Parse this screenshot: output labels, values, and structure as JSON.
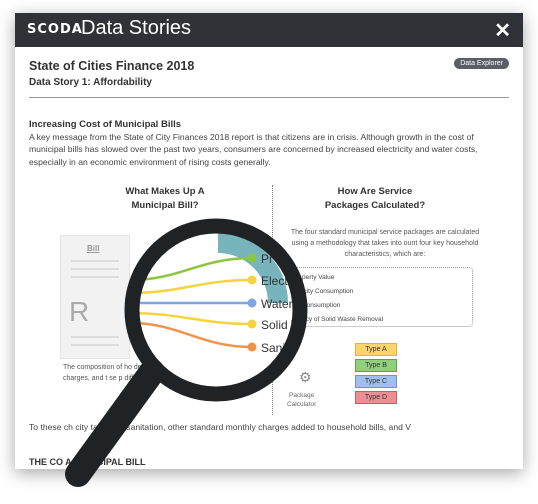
{
  "header": {
    "brand": "SCODA",
    "title": "Data Stories",
    "close_label": "✕"
  },
  "doc": {
    "title": "State of Cities Finance 2018",
    "subtitle": "Data Story 1: Affordability",
    "badge": "Data Explorer"
  },
  "section": {
    "heading": "Increasing Cost of Municipal Bills",
    "paragraph": "A key message from the State of City Finances 2018 report is that citizens are in crisis. Although growth in the cost of municipal bills has slowed over the past two years, consumers are concerned by increased electricity and water costs, especially in an economic environment of rising costs generally."
  },
  "left_column": {
    "heading_line1": "What Makes Up A",
    "heading_line2": "Municipal Bill?",
    "bill_label": "Bill",
    "bill_letter": "R",
    "magnified_items": [
      "Pr",
      "Electr",
      "Water C",
      "Solid W",
      "Sanitat"
    ],
    "caption": "The composition of ho depends on how city r charges, and t se p different s ed b"
  },
  "right_column": {
    "heading_line1": "How Are Service",
    "heading_line2": "Packages Calculated?",
    "intro": "The four standard municipal service packages are calculated using a methodology that takes into ount four key household characteristics, which are:",
    "characteristics": [
      "perty Value",
      "icity Consumption",
      "Consumption",
      "ncy of Solid Waste Removal"
    ],
    "package_label_1": "Package",
    "package_label_2": "Calculator",
    "types": [
      "Type A",
      "Type B",
      "Type C",
      "Type D"
    ]
  },
  "bottom": {
    "paragraph": "To these ch city tariffs for sanitation, other standard monthly charges added to household bills, and V",
    "heading": "THE CO A MUNICIPAL BILL"
  },
  "colors": {
    "titlebar": "#2f3236",
    "green": "#8cc63f",
    "blue": "#7da7e0",
    "yellow": "#f5d33c",
    "orange": "#f0934a",
    "teal": "#5fa7b0",
    "red": "#e06c72"
  },
  "icons": [
    "magnifier-icon",
    "gear-icon",
    "close-icon"
  ]
}
